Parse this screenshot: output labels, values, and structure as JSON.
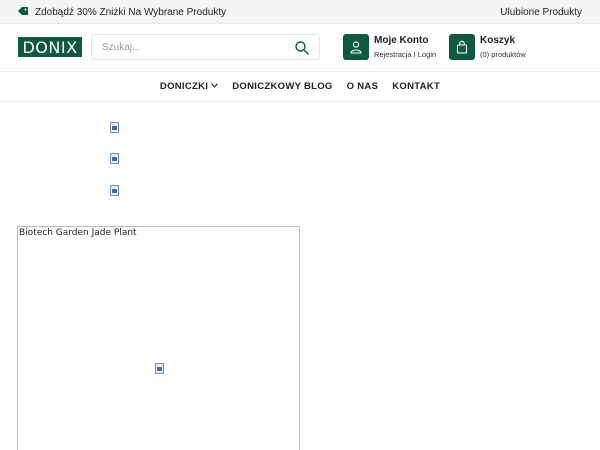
{
  "topbar": {
    "promo_text": "Zdobądź 30% Zniżki Na Wybrane Produkty",
    "favorites_label": "Ulubione Produkty"
  },
  "header": {
    "logo_text": "DONIX",
    "search": {
      "placeholder": "Szukaj...",
      "value": ""
    },
    "account": {
      "title": "Moje Konto",
      "subtitle": "Rejestracja I Login"
    },
    "cart": {
      "title": "Koszyk",
      "count_text": "(0) produktów"
    }
  },
  "nav": {
    "items": [
      {
        "label": "DONICZKI",
        "has_dropdown": true
      },
      {
        "label": "DONICZKOWY BLOG",
        "has_dropdown": false
      },
      {
        "label": "O NAS",
        "has_dropdown": false
      },
      {
        "label": "KONTAKT",
        "has_dropdown": false
      }
    ]
  },
  "product_card": {
    "name": "Biotech Garden Jade Plant"
  },
  "colors": {
    "brand_green": "#0e5a3f",
    "topbar_bg": "#f5f5f5"
  },
  "icons": {
    "promo": "tag-icon",
    "search": "search-icon",
    "account": "user-icon",
    "cart": "shopping-bag-icon",
    "dropdown": "chevron-down-icon",
    "placeholder_image": "broken-image-icon"
  }
}
